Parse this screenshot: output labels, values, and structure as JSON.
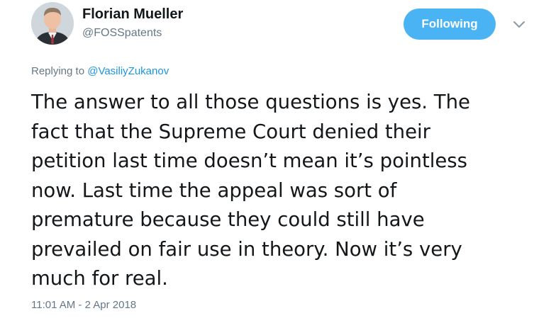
{
  "author": {
    "name": "Florian Mueller",
    "handle": "@FOSSpatents",
    "avatar_icon": "user-avatar-photo"
  },
  "follow_button": {
    "label": "Following",
    "color": "#4ab3f4"
  },
  "menu": {
    "icon": "chevron-down-icon"
  },
  "reply": {
    "prefix": "Replying to",
    "to_handle": "@VasiliyZukanov"
  },
  "tweet": {
    "lines": [
      "The answer to all those questions is yes. The",
      "fact that the Supreme Court denied their",
      "petition last time doesn’t mean it’s pointless",
      "now. Last time the appeal was sort of",
      "premature because they could still have",
      "prevailed on fair use in theory. Now it’s very",
      "much for real."
    ]
  },
  "timestamp": "11:01 AM - 2 Apr 2018",
  "colors": {
    "text": "#14171a",
    "secondary": "#657786",
    "link": "#1b95e0"
  }
}
